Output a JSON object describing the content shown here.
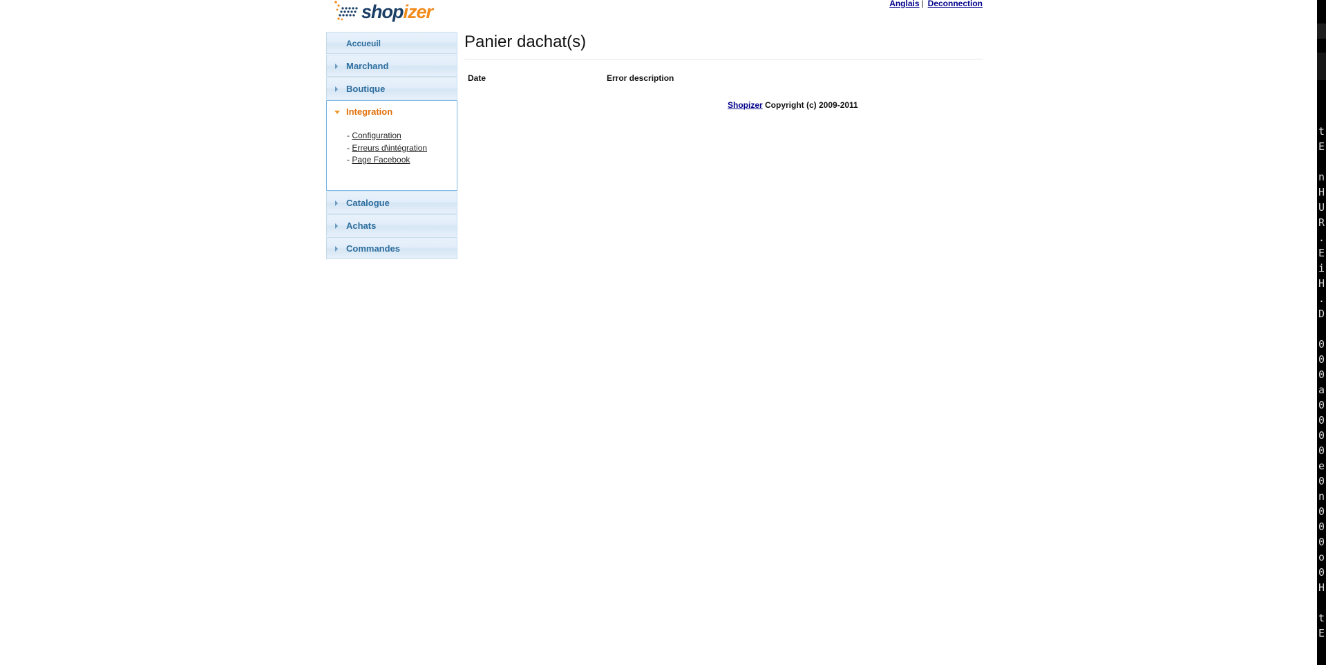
{
  "header": {
    "logo": {
      "text_prefix": "shop",
      "text_suffix": "izer",
      "colors": {
        "dark": "#1a3e66",
        "orange": "#f28a1a"
      }
    },
    "language_link": "Anglais",
    "separator": "|",
    "logout_link": "Deconnection"
  },
  "sidebar": {
    "items": [
      {
        "label": "Accueuil",
        "state": "plain"
      },
      {
        "label": "Marchand",
        "state": "collapsed"
      },
      {
        "label": "Boutique",
        "state": "collapsed"
      },
      {
        "label": "Integration",
        "state": "expanded",
        "children": [
          {
            "prefix": "- ",
            "label": "Configuration"
          },
          {
            "prefix": "- ",
            "label": "Erreurs d\\intégration"
          },
          {
            "prefix": "- ",
            "label": "Page Facebook"
          }
        ]
      },
      {
        "label": "Catalogue",
        "state": "collapsed"
      },
      {
        "label": "Achats",
        "state": "collapsed"
      },
      {
        "label": "Commandes",
        "state": "collapsed"
      }
    ],
    "colors": {
      "header_text": "#2e6e9e",
      "active_text": "#e17009",
      "active_arrow": "#f29a2e"
    }
  },
  "main": {
    "title": "Panier dachat(s)",
    "table": {
      "columns": [
        "Date",
        "Error description"
      ],
      "rows": []
    },
    "footer": {
      "link": "Shopizer",
      "text": " Copyright (c) 2009-2011"
    }
  },
  "terminal_strip": {
    "lines": [
      "t",
      "E",
      "",
      "n",
      "H",
      "U",
      "R",
      ".",
      "E",
      "i",
      "H",
      ".",
      "D",
      "",
      "0",
      "0",
      "0",
      "a",
      "0",
      "0",
      "0",
      "0",
      "e",
      "0",
      "n",
      "0",
      "0",
      "0",
      "o",
      "0",
      "H",
      "",
      "t",
      "E",
      "",
      ""
    ]
  }
}
